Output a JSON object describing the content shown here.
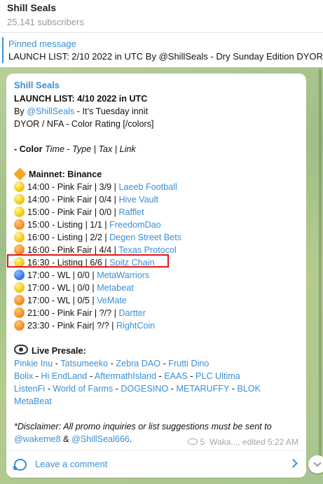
{
  "header": {
    "title": "Shill Seals",
    "subscribers": "25,141 subscribers"
  },
  "pinned": {
    "label": "Pinned message",
    "text": "LAUNCH LIST:  2/10 2022 in UTC By @ShillSeals - Dry Sunday Edition DYOR /"
  },
  "message": {
    "sender": "Shill Seals",
    "title": "LAUNCH LIST:  4/10 2022 in UTC",
    "by_prefix": "By ",
    "by_link": "@ShillSeals",
    "by_suffix": " - It’s Tuesday innit",
    "dyor": "DYOR / NFA - Color Rating [/colors]",
    "legend": {
      "prefix": "- ",
      "color": "Color",
      "rest": " Time - Type | Tax | Link"
    },
    "section_mainnet": "Mainnet: Binance",
    "launches": [
      {
        "color": "yellow",
        "text": "14:00 - Pink Fair | 3/9 | ",
        "link": "Laeeb Football"
      },
      {
        "color": "yellow",
        "text": "14:00 - Pink Fair | 0/4 | ",
        "link": "Hive Vault"
      },
      {
        "color": "yellow",
        "text": "15:00 - Pink Fair | 0/0 | ",
        "link": "Rafflet"
      },
      {
        "color": "orange",
        "text": "15:00 - Listing | 1/1 | ",
        "link": "FreedomDao"
      },
      {
        "color": "yellow",
        "text": "16:00 - Listing | 2/2 | ",
        "link": "Degen Street Bets"
      },
      {
        "color": "orange",
        "text": "16:00 - Pink Fair | 4/4 | ",
        "link": "Texas Protocol"
      },
      {
        "color": "yellow",
        "text": "16:30 - Listing | 6/6 | ",
        "link": "Spitz Chain"
      },
      {
        "color": "blue",
        "text": "17:00 - WL | 0/0 | ",
        "link": "MetaWarriors"
      },
      {
        "color": "yellow",
        "text": "17:00 - WL | 0/0 | ",
        "link": "Metabeat"
      },
      {
        "color": "orange",
        "text": "17:00 - WL | 0/5 | ",
        "link": "VeMate"
      },
      {
        "color": "orange",
        "text": "21:00 - Pink Fair | ?/? | ",
        "link": "Dartter"
      },
      {
        "color": "orange",
        "text": "23:30 - Pink Fair| ?/? | ",
        "link": "RightCoin"
      }
    ],
    "section_presale": "Live Presale:",
    "presale_lines": [
      [
        "Pinkie Inu",
        "Tatsumeeko",
        "Zebra DAO",
        "Frutti Dino"
      ],
      [
        "Bolix",
        "Hi EndLand",
        "AftermathIsland",
        "EAAS",
        "PLC Ultima"
      ],
      [
        "ListenFi",
        "World of Farms",
        "DOGESINO",
        "METARUFFY",
        "BLOK"
      ],
      [
        "MetaBeat"
      ]
    ],
    "separator": " - ",
    "disclaimer": "*Disclaimer: All promo inquiries or list suggestions must be sent to",
    "contact1": "@wakeme8",
    "contact_amp": " & ",
    "contact2": "@ShillSeal666",
    "contact_end": ".",
    "views": "5",
    "author_edit": "Waka..., edited 5:22 AM"
  },
  "comment": {
    "label": "Leave a comment"
  },
  "colors": {
    "accent": "#3a8fd6",
    "highlight": "#e01818"
  }
}
